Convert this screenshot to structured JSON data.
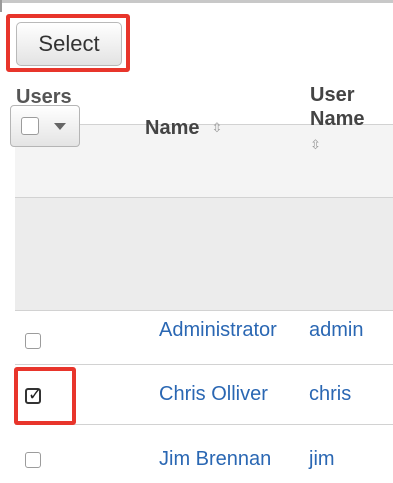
{
  "toolbar": {
    "select_label": "Select"
  },
  "section": {
    "title": "Users"
  },
  "table": {
    "headers": {
      "name": "Name",
      "user_name_line1": "User",
      "user_name_line2": "Name",
      "sort_icon": "⇳"
    },
    "rows": [
      {
        "name": "Administrator",
        "user_name": "admin",
        "checked": false
      },
      {
        "name": "Chris Olliver",
        "user_name": "chris",
        "checked": true
      },
      {
        "name": "Jim Brennan",
        "user_name": "jim",
        "checked": false
      }
    ]
  },
  "icons": {
    "mass_checkbox": "checkbox-icon",
    "dropdown": "caret-down-icon",
    "checkmark": "✓"
  },
  "colors": {
    "highlight": "#e8352b",
    "link": "#2a67b3",
    "header_bg": "#ececec"
  }
}
